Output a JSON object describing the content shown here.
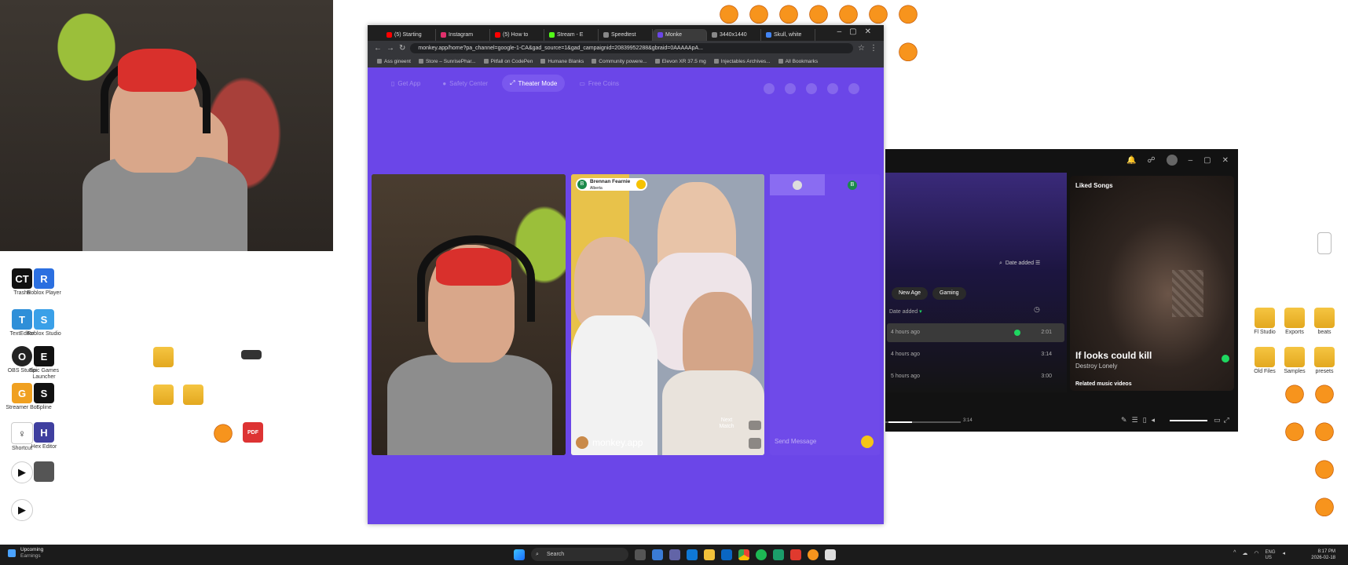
{
  "browser": {
    "tabs": [
      {
        "label": "(5) Starting",
        "color": "#ff0000"
      },
      {
        "label": "Instagram",
        "color": "#e1306c"
      },
      {
        "label": "(5) How to",
        "color": "#ff0000"
      },
      {
        "label": "Stream - E",
        "color": "#53fc18"
      },
      {
        "label": "Speedtest",
        "color": "#888888"
      },
      {
        "label": "Monke",
        "color": "#6b46e8"
      },
      {
        "label": "3440x1440",
        "color": "#888888"
      },
      {
        "label": "Skull, white",
        "color": "#4285f4"
      }
    ],
    "url": "monkey.app/home?pa_channel=google-1-CA&gad_source=1&gad_campaignid=20839952288&gbraid=0AAAAApA...",
    "bookmarks": [
      "Ass gineent",
      "Store – SunrisePhar...",
      "Pitfall on CodePen",
      "Humane Blanks",
      "Community powere...",
      "Elevon XR 37.5 mg",
      "Injectables Archives...",
      "All Bookmarks"
    ]
  },
  "monkey": {
    "nav": [
      "Get App",
      "Safety Center",
      "Theater Mode",
      "Free Coins"
    ],
    "match_name": "Brennan Fearnie",
    "match_location": "Alberta",
    "match_badge": "B",
    "logo_text": "monkey.app",
    "next_match": "Next Match",
    "chat_placeholder": "Send Message",
    "chat_tab_badge": "B"
  },
  "spotify": {
    "sort_label": "Date added",
    "chips": [
      "New Age",
      "Gaming"
    ],
    "column_header": "Date added",
    "rows": [
      {
        "added": "4 hours ago",
        "duration": "2:01"
      },
      {
        "added": "4 hours ago",
        "duration": "3:14"
      },
      {
        "added": "5 hours ago",
        "duration": "3:00"
      }
    ],
    "now_playing_title": "Liked Songs",
    "song": "If looks could kill",
    "artist": "Destroy Lonely",
    "related": "Related music videos",
    "time_total": "3:14"
  },
  "desktop": {
    "icons": [
      {
        "label": "Trash5",
        "color": "#111111",
        "glyph": "CT"
      },
      {
        "label": "Roblox Player",
        "color": "#2b6fe0",
        "glyph": "R"
      },
      {
        "label": "TextEditor",
        "color": "#2f8fd8",
        "glyph": "T"
      },
      {
        "label": "Roblox Studio",
        "color": "#3aa0e8",
        "glyph": "S"
      },
      {
        "label": "OBS Studio",
        "color": "#222222",
        "glyph": "O"
      },
      {
        "label": "Epic Games Launcher",
        "color": "#111111",
        "glyph": "E"
      },
      {
        "label": "Streamer Bot",
        "color": "#f0a020",
        "glyph": "G"
      },
      {
        "label": "Spline",
        "color": "#111111",
        "glyph": "S"
      },
      {
        "label": "Shortcut",
        "color": "#ffffff",
        "glyph": "♀"
      },
      {
        "label": "Hex Editor",
        "color": "#3f3f9f",
        "glyph": "H"
      }
    ],
    "right_labels": [
      "Fl Studio",
      "Exports",
      "beats",
      "Old Files",
      "Samples",
      "presets"
    ]
  },
  "taskbar": {
    "weather_title": "Upcoming",
    "weather_sub": "Earnings",
    "search": "Search",
    "lang": "ENG US",
    "time": "8:17 PM",
    "date": "2026-02-18"
  }
}
